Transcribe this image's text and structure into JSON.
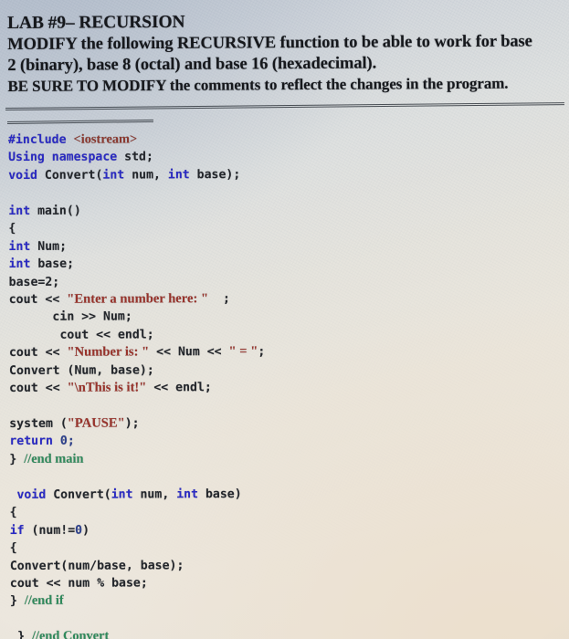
{
  "document": {
    "kind": "photographed-printout",
    "heading": {
      "line1": "LAB #9– RECURSION",
      "line2": "MODIFY the following RECURSIVE function to be able to work for base",
      "line3": "2 (binary), base 8 (octal) and base 16 (hexadecimal).",
      "line4": "BE SURE TO MODIFY the comments to reflect the changes in the program."
    },
    "colors": {
      "keyword": "#2a2ac4",
      "string": "#9a332b",
      "comment": "#2f8a5b",
      "include_header": "#8d3a30",
      "plain_text": "#23262b",
      "number": "#2c3f8c",
      "paper_cool": "#c5cbd4",
      "paper_warm": "#ece7de",
      "rule": "#2b3138"
    },
    "code": {
      "language": "C++",
      "lines": [
        {
          "indent": 0,
          "tokens": [
            {
              "t": "kw",
              "v": "#include"
            },
            {
              "t": "pl",
              "v": " "
            },
            {
              "t": "inc",
              "v": "<iostream>"
            }
          ]
        },
        {
          "indent": 0,
          "tokens": [
            {
              "t": "kw",
              "v": "Using namespace"
            },
            {
              "t": "pl",
              "v": " std;"
            }
          ]
        },
        {
          "indent": 0,
          "tokens": [
            {
              "t": "kw",
              "v": "void"
            },
            {
              "t": "pl",
              "v": " Convert("
            },
            {
              "t": "kw",
              "v": "int"
            },
            {
              "t": "pl",
              "v": " num, "
            },
            {
              "t": "kw",
              "v": "int"
            },
            {
              "t": "pl",
              "v": " base);"
            }
          ]
        },
        {
          "indent": 0,
          "tokens": []
        },
        {
          "indent": 0,
          "tokens": [
            {
              "t": "kw",
              "v": "int"
            },
            {
              "t": "pl",
              "v": " main()"
            }
          ]
        },
        {
          "indent": 0,
          "tokens": [
            {
              "t": "pl",
              "v": "{"
            }
          ]
        },
        {
          "indent": 0,
          "tokens": [
            {
              "t": "kw",
              "v": "int"
            },
            {
              "t": "pl",
              "v": " Num;"
            }
          ]
        },
        {
          "indent": 0,
          "tokens": [
            {
              "t": "kw",
              "v": "int"
            },
            {
              "t": "pl",
              "v": " base;"
            }
          ]
        },
        {
          "indent": 0,
          "tokens": [
            {
              "t": "pl",
              "v": "base=2;"
            }
          ]
        },
        {
          "indent": 0,
          "tokens": [
            {
              "t": "pl",
              "v": "cout << "
            },
            {
              "t": "str",
              "v": "\"Enter a number here: \""
            },
            {
              "t": "pl",
              "v": "  ;"
            }
          ]
        },
        {
          "indent": 6,
          "tokens": [
            {
              "t": "pl",
              "v": "cin >> Num;"
            }
          ]
        },
        {
          "indent": 7,
          "tokens": [
            {
              "t": "pl",
              "v": "cout << endl;"
            }
          ]
        },
        {
          "indent": 0,
          "tokens": [
            {
              "t": "pl",
              "v": "cout << "
            },
            {
              "t": "str",
              "v": "\"Number is: \""
            },
            {
              "t": "pl",
              "v": " << Num << "
            },
            {
              "t": "str",
              "v": "\" = \""
            },
            {
              "t": "pl",
              "v": ";"
            }
          ]
        },
        {
          "indent": 0,
          "tokens": [
            {
              "t": "pl",
              "v": "Convert (Num, base);"
            }
          ]
        },
        {
          "indent": 0,
          "tokens": [
            {
              "t": "pl",
              "v": "cout << "
            },
            {
              "t": "str",
              "v": "\"\\nThis is it!\""
            },
            {
              "t": "pl",
              "v": " << endl;"
            }
          ]
        },
        {
          "indent": 0,
          "tokens": []
        },
        {
          "indent": 0,
          "tokens": [
            {
              "t": "pl",
              "v": "system ("
            },
            {
              "t": "str",
              "v": "\"PAUSE\""
            },
            {
              "t": "pl",
              "v": ");"
            }
          ]
        },
        {
          "indent": 0,
          "tokens": [
            {
              "t": "kw",
              "v": "return"
            },
            {
              "t": "pl",
              "v": " "
            },
            {
              "t": "num",
              "v": "0;"
            }
          ]
        },
        {
          "indent": 0,
          "tokens": [
            {
              "t": "pl",
              "v": "} "
            },
            {
              "t": "cmt",
              "v": "//end main"
            }
          ]
        },
        {
          "indent": 0,
          "tokens": []
        },
        {
          "indent": 1,
          "tokens": [
            {
              "t": "kw",
              "v": "void"
            },
            {
              "t": "pl",
              "v": " Convert("
            },
            {
              "t": "kw",
              "v": "int"
            },
            {
              "t": "pl",
              "v": " num, "
            },
            {
              "t": "kw",
              "v": "int"
            },
            {
              "t": "pl",
              "v": " base)"
            }
          ]
        },
        {
          "indent": 0,
          "tokens": [
            {
              "t": "pl",
              "v": "{"
            }
          ]
        },
        {
          "indent": 0,
          "tokens": [
            {
              "t": "kw",
              "v": "if"
            },
            {
              "t": "pl",
              "v": " (num!="
            },
            {
              "t": "num",
              "v": "0"
            },
            {
              "t": "pl",
              "v": ")"
            }
          ]
        },
        {
          "indent": 0,
          "tokens": [
            {
              "t": "pl",
              "v": "{"
            }
          ]
        },
        {
          "indent": 0,
          "tokens": [
            {
              "t": "pl",
              "v": "Convert(num/base, base);"
            }
          ]
        },
        {
          "indent": 0,
          "tokens": [
            {
              "t": "pl",
              "v": "cout << num % base;"
            }
          ]
        },
        {
          "indent": 0,
          "tokens": [
            {
              "t": "pl",
              "v": "} "
            },
            {
              "t": "cmt",
              "v": "//end if"
            }
          ]
        },
        {
          "indent": 0,
          "tokens": []
        },
        {
          "indent": 1,
          "tokens": [
            {
              "t": "pl",
              "v": "} "
            },
            {
              "t": "cmt",
              "v": "//end Convert"
            }
          ]
        }
      ]
    }
  }
}
